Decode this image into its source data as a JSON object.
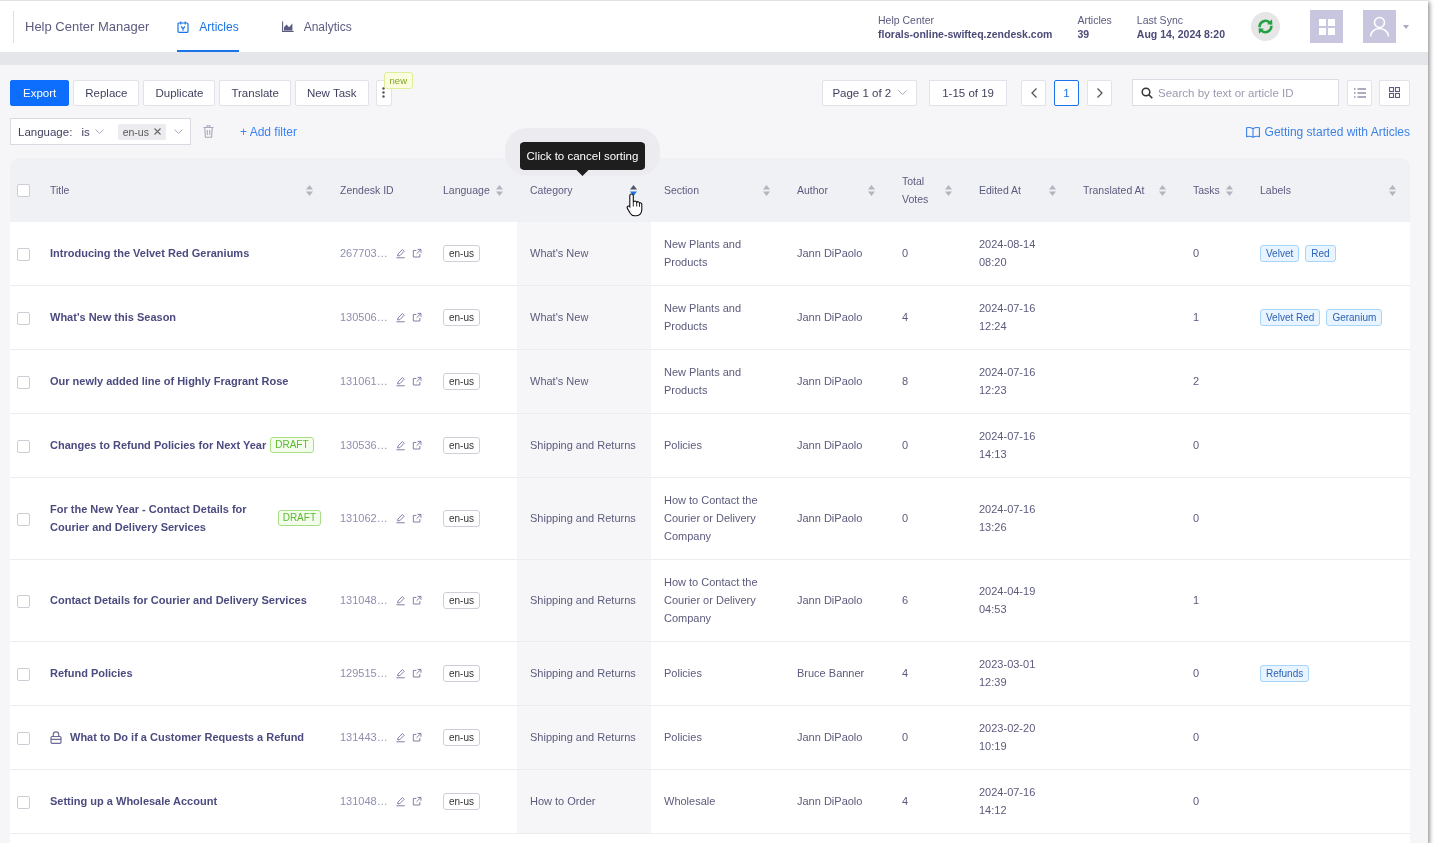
{
  "nav": {
    "app_title": "Help Center Manager",
    "tabs": [
      {
        "label": "Articles",
        "selected": true
      },
      {
        "label": "Analytics",
        "selected": false
      }
    ],
    "info": [
      {
        "label": "Help Center",
        "value": "florals-online-swifteq.zendesk.com"
      },
      {
        "label": "Articles",
        "value": "39"
      },
      {
        "label": "Last Sync",
        "value": "Aug 14, 2024 8:20"
      }
    ]
  },
  "toolbar": {
    "actions": [
      {
        "label": "Export",
        "primary": true
      },
      {
        "label": "Replace",
        "primary": false
      },
      {
        "label": "Duplicate",
        "primary": false
      },
      {
        "label": "Translate",
        "primary": false
      },
      {
        "label": "New Task",
        "primary": false
      }
    ],
    "more_badge": "new",
    "page_select": "Page 1 of 2",
    "range": "1-15 of 19",
    "pages": [
      {
        "label": "1",
        "selected": true
      }
    ],
    "search": {
      "placeholder": "Search by text or article ID"
    }
  },
  "filter_bar": {
    "filters": [
      {
        "field": "Language:",
        "operator": "is",
        "values": [
          "en-us"
        ]
      }
    ],
    "add_filter": "+ Add filter",
    "help_link": "Getting started with Articles"
  },
  "table": {
    "all_checked": false,
    "columns": [
      {
        "label": "Title",
        "sortable": true,
        "sorted": false
      },
      {
        "label": "Zendesk ID",
        "sortable": false
      },
      {
        "label": "Language",
        "sortable": true,
        "sorted": false
      },
      {
        "label": "Category",
        "sortable": true,
        "sorted": true,
        "descending": true,
        "tooltip": "Click to cancel sorting"
      },
      {
        "label": "Section",
        "sortable": true,
        "sorted": false
      },
      {
        "label": "Author",
        "sortable": true,
        "sorted": false
      },
      {
        "label": "Total Votes",
        "sortable": true,
        "sorted": false
      },
      {
        "label": "Edited At",
        "sortable": true,
        "sorted": false
      },
      {
        "label": "Translated At",
        "sortable": true,
        "sorted": false
      },
      {
        "label": "Tasks",
        "sortable": true,
        "sorted": false
      },
      {
        "label": "Labels",
        "sortable": true,
        "sorted": false
      }
    ],
    "rows": [
      {
        "checked": false,
        "locked": false,
        "title": "Introducing the Velvet Red Geraniums",
        "zendesk_id": "267703…",
        "language": "en-us",
        "category": "What's New",
        "section": "New Plants and Products",
        "author": "Jann DiPaolo",
        "total_votes": "0",
        "edited_at": "2024-08-14 08:20",
        "tasks": "0",
        "labels": [
          "Velvet",
          "Red"
        ]
      },
      {
        "checked": false,
        "locked": false,
        "title": "What's New this Season",
        "zendesk_id": "130506…",
        "language": "en-us",
        "category": "What's New",
        "section": "New Plants and Products",
        "author": "Jann DiPaolo",
        "total_votes": "4",
        "edited_at": "2024-07-16 12:24",
        "tasks": "1",
        "labels": [
          "Velvet Red",
          "Geranium"
        ]
      },
      {
        "checked": false,
        "locked": false,
        "title": "Our newly added line of Highly Fragrant Rose",
        "zendesk_id": "131061…",
        "language": "en-us",
        "category": "What's New",
        "section": "New Plants and Products",
        "author": "Jann DiPaolo",
        "total_votes": "8",
        "edited_at": "2024-07-16 12:23",
        "tasks": "2"
      },
      {
        "checked": false,
        "locked": false,
        "title": "Changes to Refund Policies for Next Year",
        "badge": "DRAFT",
        "zendesk_id": "130536…",
        "language": "en-us",
        "category": "Shipping and Returns",
        "section": "Policies",
        "author": "Jann DiPaolo",
        "total_votes": "0",
        "edited_at": "2024-07-16 14:13",
        "tasks": "0"
      },
      {
        "checked": false,
        "locked": false,
        "title": "For the New Year - Contact Details for Courier and Delivery Services",
        "badge": "DRAFT",
        "zendesk_id": "131062…",
        "language": "en-us",
        "category": "Shipping and Returns",
        "section": "How to Contact the Courier or Delivery Company",
        "author": "Jann DiPaolo",
        "total_votes": "0",
        "edited_at": "2024-07-16 13:26",
        "tasks": "0"
      },
      {
        "checked": false,
        "locked": false,
        "title": "Contact Details for Courier and Delivery Services",
        "zendesk_id": "131048…",
        "language": "en-us",
        "category": "Shipping and Returns",
        "section": "How to Contact the Courier or Delivery Company",
        "author": "Jann DiPaolo",
        "total_votes": "6",
        "edited_at": "2024-04-19 04:53",
        "tasks": "1"
      },
      {
        "checked": false,
        "locked": false,
        "title": "Refund Policies",
        "zendesk_id": "129515…",
        "language": "en-us",
        "category": "Shipping and Returns",
        "section": "Policies",
        "author": "Bruce Banner",
        "total_votes": "4",
        "edited_at": "2023-03-01 12:39",
        "tasks": "0",
        "labels": [
          "Refunds"
        ]
      },
      {
        "checked": false,
        "locked": true,
        "title": "What to Do if a Customer Requests a Refund",
        "zendesk_id": "131443…",
        "language": "en-us",
        "category": "Shipping and Returns",
        "section": "Policies",
        "author": "Jann DiPaolo",
        "total_votes": "0",
        "edited_at": "2023-02-20 10:19",
        "tasks": "0"
      },
      {
        "checked": false,
        "locked": false,
        "title": "Setting up a Wholesale Account",
        "zendesk_id": "131048…",
        "language": "en-us",
        "category": "How to Order",
        "section": "Wholesale",
        "author": "Jann DiPaolo",
        "total_votes": "4",
        "edited_at": "2024-07-16 14:12",
        "tasks": "0"
      }
    ]
  }
}
